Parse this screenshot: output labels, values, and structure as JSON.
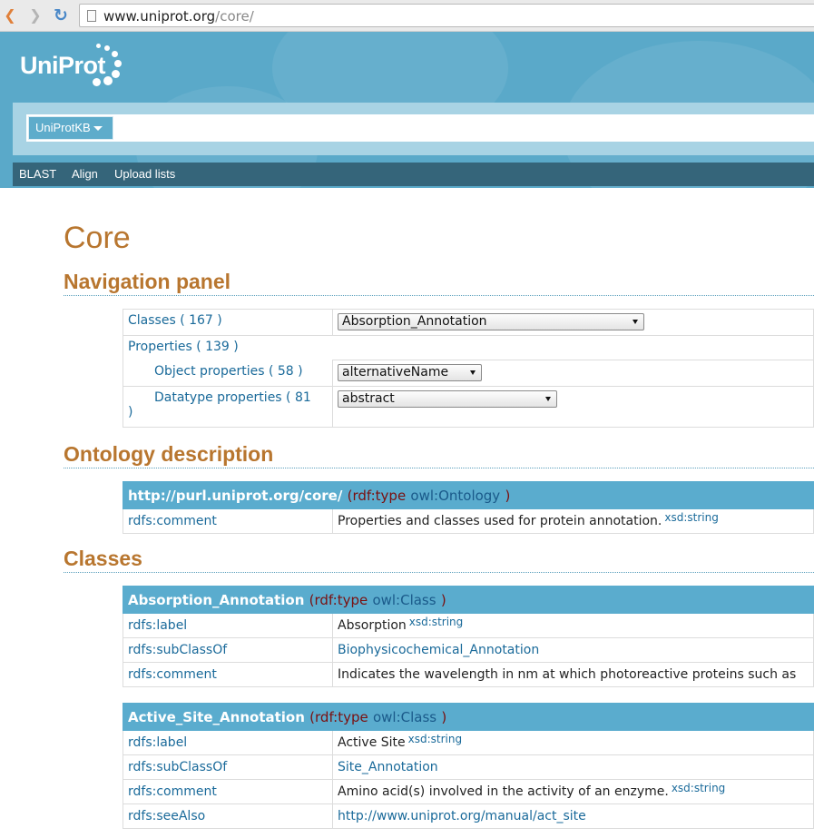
{
  "browser": {
    "url_host": "www.uniprot.org",
    "url_path": "/core/"
  },
  "header": {
    "logo": "UniProt",
    "db_select": "UniProtKB",
    "nav": [
      "BLAST",
      "Align",
      "Upload lists"
    ]
  },
  "page": {
    "title": "Core"
  },
  "nav_panel": {
    "heading": "Navigation panel",
    "classes_label": "Classes ( 167 )",
    "classes_select": "Absorption_Annotation",
    "properties_label": "Properties ( 139 )",
    "object_label": "Object properties ( 58 )",
    "object_select": "alternativeName",
    "datatype_label": "Datatype properties ( 81",
    "datatype_label_cont": ")",
    "datatype_select": "abstract"
  },
  "ontology": {
    "heading": "Ontology description",
    "uri": "http://purl.uniprot.org/core/",
    "paren_open": "(",
    "rdf_type": "rdf:type",
    "type_value": "owl:Ontology",
    "paren_close": ")",
    "comment_key": "rdfs:comment",
    "comment_value": "Properties and classes used for protein annotation.",
    "comment_type": "xsd:string"
  },
  "classes": {
    "heading": "Classes",
    "items": [
      {
        "name": "Absorption_Annotation",
        "rdf_type": "rdf:type",
        "type_value": "owl:Class",
        "label_key": "rdfs:label",
        "label_value": "Absorption",
        "label_type": "xsd:string",
        "subclass_key": "rdfs:subClassOf",
        "subclass_value": "Biophysicochemical_Annotation",
        "comment_key": "rdfs:comment",
        "comment_value": "Indicates the wavelength in nm at which photoreactive proteins such as"
      },
      {
        "name": "Active_Site_Annotation",
        "rdf_type": "rdf:type",
        "type_value": "owl:Class",
        "label_key": "rdfs:label",
        "label_value": "Active Site",
        "label_type": "xsd:string",
        "subclass_key": "rdfs:subClassOf",
        "subclass_value": "Site_Annotation",
        "comment_key": "rdfs:comment",
        "comment_value": "Amino acid(s) involved in the activity of an enzyme.",
        "comment_type": "xsd:string",
        "seealso_key": "rdfs:seeAlso",
        "seealso_value": "http://www.uniprot.org/manual/act_site"
      }
    ]
  },
  "colors": {
    "header_blue": "#5aa9c9",
    "subnav_dark": "#35657a",
    "heading_brown": "#b8762f",
    "link_blue": "#1a6a9a",
    "table_head": "#5aacce"
  }
}
